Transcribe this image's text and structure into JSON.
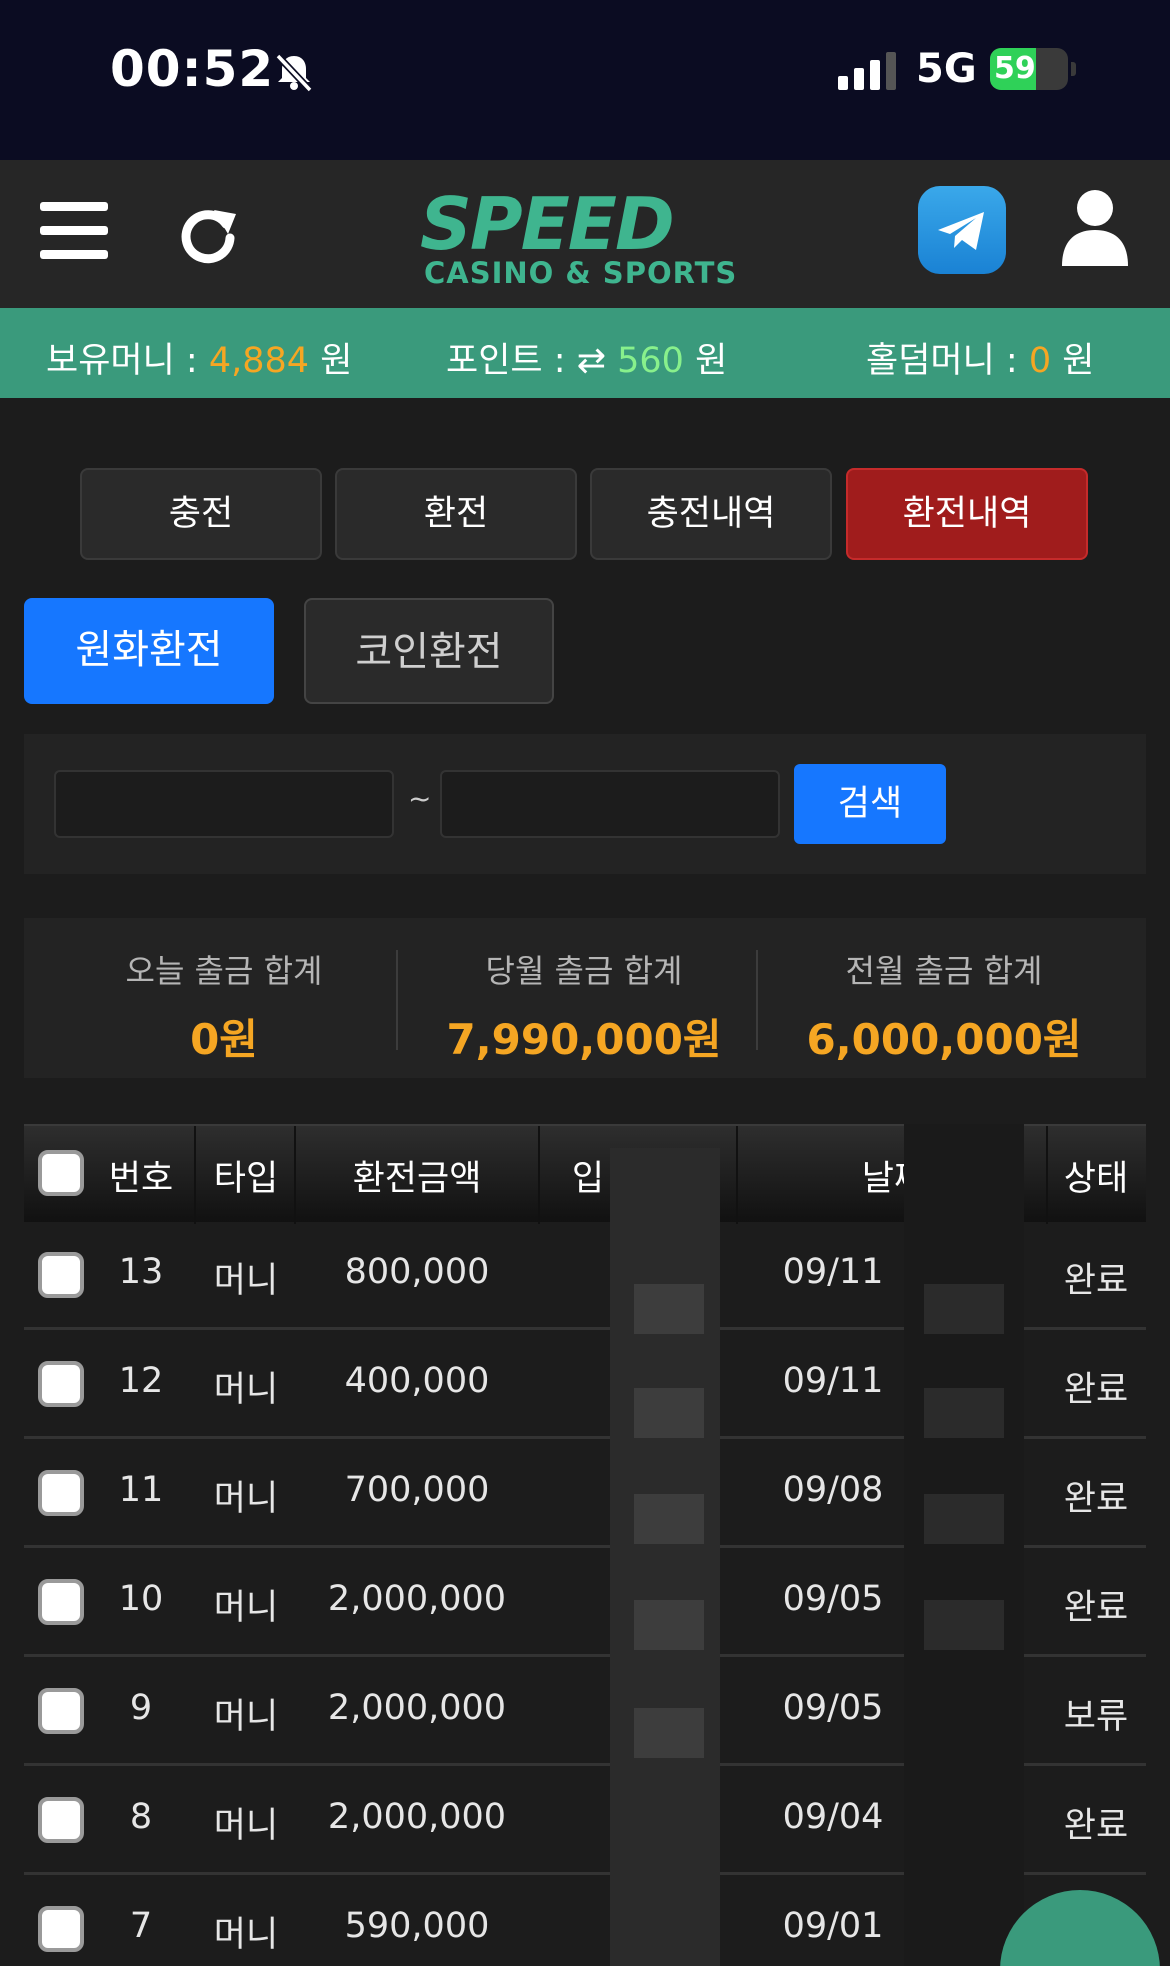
{
  "status_bar": {
    "time": "00:52",
    "network": "5G",
    "battery": "59",
    "battery_level": 0.59
  },
  "header": {
    "logo_main": "SPEED",
    "logo_sub": "CASINO & SPORTS",
    "icons": [
      "menu-icon",
      "refresh-icon",
      "telegram-icon",
      "user-icon"
    ]
  },
  "money_bar": {
    "balance_label": "보유머니 :",
    "balance_value": "4,884",
    "point_label": "포인트 :",
    "point_value": "560",
    "holdem_label": "홀덤머니 :",
    "holdem_value": "0",
    "unit": "원"
  },
  "tabs": [
    {
      "label": "충전",
      "active": false
    },
    {
      "label": "환전",
      "active": false
    },
    {
      "label": "충전내역",
      "active": false
    },
    {
      "label": "환전내역",
      "active": true
    }
  ],
  "sub_tabs": [
    {
      "label": "원화환전",
      "active": true
    },
    {
      "label": "코인환전",
      "active": false
    }
  ],
  "search": {
    "from_value": "",
    "to_value": "",
    "separator": "~",
    "button_label": "검색"
  },
  "summary": [
    {
      "label": "오늘 출금 합계",
      "value": "0원"
    },
    {
      "label": "당월 출금 합계",
      "value": "7,990,000원"
    },
    {
      "label": "전월 출금 합계",
      "value": "6,000,000원"
    }
  ],
  "table": {
    "headers": [
      "번호",
      "타입",
      "환전금액",
      "입",
      "날짜",
      "상태"
    ],
    "rows": [
      {
        "no": "13",
        "type": "머니",
        "amount": "800,000",
        "date": "09/11",
        "status": "완료"
      },
      {
        "no": "12",
        "type": "머니",
        "amount": "400,000",
        "date": "09/11",
        "status": "완료"
      },
      {
        "no": "11",
        "type": "머니",
        "amount": "700,000",
        "date": "09/08",
        "status": "완료"
      },
      {
        "no": "10",
        "type": "머니",
        "amount": "2,000,000",
        "date": "09/05",
        "status": "완료"
      },
      {
        "no": "9",
        "type": "머니",
        "amount": "2,000,000",
        "date": "09/05",
        "status": "보류"
      },
      {
        "no": "8",
        "type": "머니",
        "amount": "2,000,000",
        "date": "09/04",
        "status": "완료"
      },
      {
        "no": "7",
        "type": "머니",
        "amount": "590,000",
        "date": "09/01",
        "status": ""
      }
    ]
  },
  "colors": {
    "brand_green": "#3fb58f",
    "money_bar": "#3a9a7c",
    "accent_orange": "#f5a623",
    "active_tab_red": "#a01c1c",
    "primary_blue": "#1677ff"
  }
}
